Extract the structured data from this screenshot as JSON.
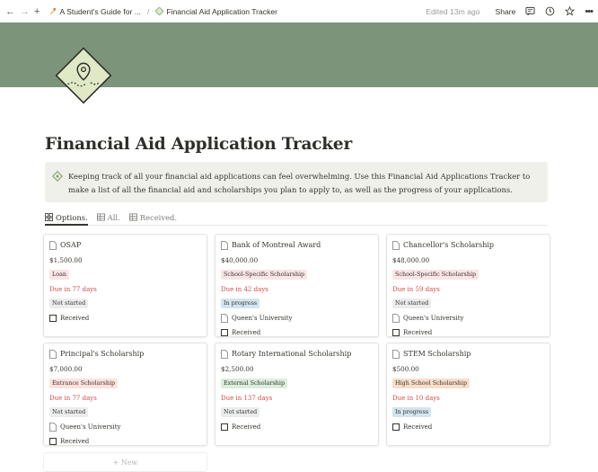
{
  "topbar": {
    "back_icon": "arrow-left-icon",
    "forward_icon": "arrow-right-icon",
    "add_icon": "plus-icon",
    "breadcrumb": [
      {
        "label": "A Student's Guide for ...",
        "icon": "student-guide-icon"
      },
      {
        "label": "Financial Aid Application Tracker",
        "icon": "compass-icon"
      }
    ],
    "separator": "/",
    "edited": "Edited 13m ago",
    "share": "Share",
    "icons": [
      "comment-icon",
      "clock-icon",
      "star-icon",
      "more-icon"
    ]
  },
  "page": {
    "title": "Financial Aid Application Tracker",
    "cover_color": "#7b947a",
    "callout": "Keeping track of all your financial aid applications can feel overwhelming. Use this Financial Aid Applications Tracker to make a list of all the financial aid and scholarships you plan to apply to, as well as the progress of your applications."
  },
  "views": [
    {
      "label": "Options.",
      "icon": "gallery-icon",
      "active": true
    },
    {
      "label": "All.",
      "icon": "table-icon",
      "active": false
    },
    {
      "label": "Received.",
      "icon": "table-icon",
      "active": false
    }
  ],
  "cards": [
    {
      "title": "OSAP",
      "amount": "$1,500.00",
      "type": "Loan",
      "type_color": "#fbe4e4",
      "due": "Due in 77 days",
      "status": "Not started",
      "status_color": "#ebeced",
      "university": "",
      "received": "Received"
    },
    {
      "title": "Bank of Montreal Award",
      "amount": "$40,000.00",
      "type": "School-Specific Scholarship",
      "type_color": "#fbe4e4",
      "due": "Due in 42 days",
      "status": "In progress",
      "status_color": "#d3e5ef",
      "university": "Queen's University",
      "received": "Received"
    },
    {
      "title": "Chancellor's Scholarship",
      "amount": "$48,000.00",
      "type": "School-Specific Scholarship",
      "type_color": "#fbe4e4",
      "due": "Due in 59 days",
      "status": "Not started",
      "status_color": "#ebeced",
      "university": "Queen's University",
      "received": "Received"
    },
    {
      "title": "Principal's Scholarship",
      "amount": "$7,000.00",
      "type": "Entrance Scholarship",
      "type_color": "#ffe2dd",
      "due": "Due in 77 days",
      "status": "Not started",
      "status_color": "#ebeced",
      "university": "Queen's University",
      "received": "Received"
    },
    {
      "title": "Rotary International Scholarship",
      "amount": "$2,500.00",
      "type": "External Scholarship",
      "type_color": "#dbeddb",
      "due": "Due in 137 days",
      "status": "Not started",
      "status_color": "#ebeced",
      "university": "",
      "received": "Received"
    },
    {
      "title": "STEM Scholarship",
      "amount": "$500.00",
      "type": "High School Scholarship",
      "type_color": "#fadec9",
      "due": "Due in 10 days",
      "status": "In progress",
      "status_color": "#d3e5ef",
      "university": "",
      "received": "Received"
    }
  ],
  "new_label": "+ New"
}
